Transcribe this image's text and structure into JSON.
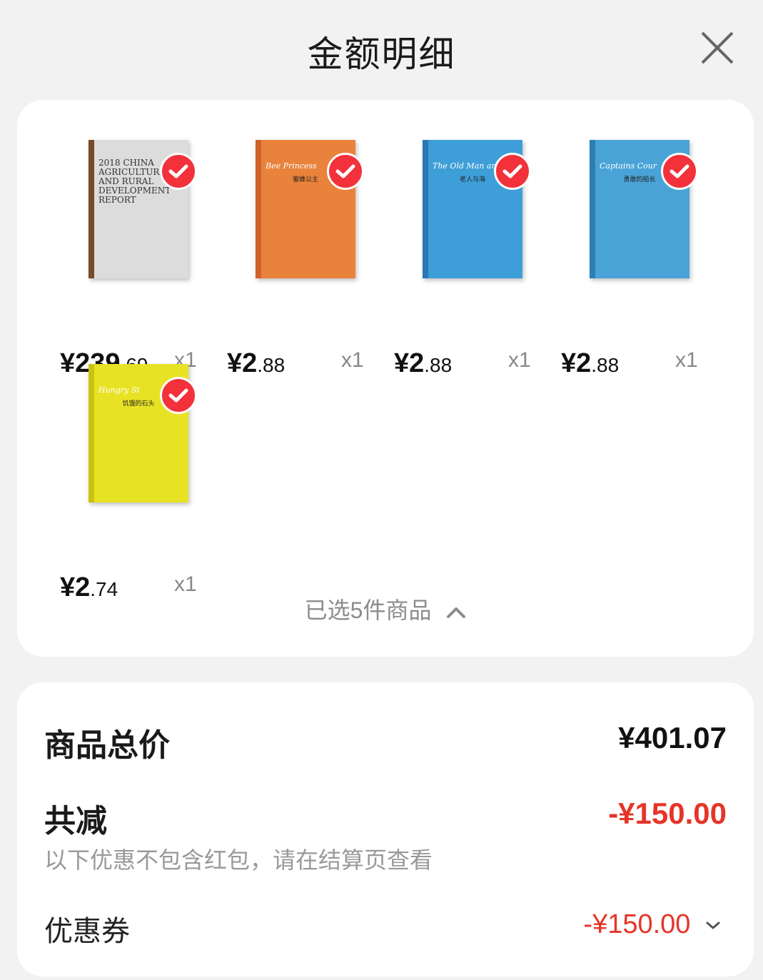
{
  "header": {
    "title": "金额明细",
    "close_icon": "close-icon"
  },
  "products": [
    {
      "price_int": "¥239",
      "price_dec": ".69",
      "qty": "x1",
      "cover_text": "2018 CHINA AGRICULTURAL AND RURAL DEVELOPMENT REPORT",
      "subtitle": "",
      "cover_color": "#dcdcdc",
      "spine_color": "#7a4a2a",
      "checked": true
    },
    {
      "price_int": "¥2",
      "price_dec": ".88",
      "qty": "x1",
      "cover_text": "Bee Princess",
      "subtitle": "蜜蜂公主",
      "cover_color": "#e9823b",
      "spine_color": "#d2602a",
      "checked": true
    },
    {
      "price_int": "¥2",
      "price_dec": ".88",
      "qty": "x1",
      "cover_text": "The Old Man and",
      "subtitle": "老人与海",
      "cover_color": "#3e9ed8",
      "spine_color": "#2a78b5",
      "checked": true
    },
    {
      "price_int": "¥2",
      "price_dec": ".88",
      "qty": "x1",
      "cover_text": "Captains Cour",
      "subtitle": "勇敢的船长",
      "cover_color": "#4aa3d6",
      "spine_color": "#2d7fb3",
      "checked": true
    },
    {
      "price_int": "¥2",
      "price_dec": ".74",
      "qty": "x1",
      "cover_text": "Hungry St",
      "subtitle": "饥饿的石头",
      "cover_color": "#e8e224",
      "spine_color": "#c9c210",
      "checked": true
    }
  ],
  "selection": {
    "label": "已选5件商品",
    "icon": "chevron-up-icon"
  },
  "summary": {
    "total_label": "商品总价",
    "total_value": "¥401.07",
    "discount_label": "共减",
    "discount_value": "-¥150.00",
    "note": "以下优惠不包含红包，请在结算页查看",
    "coupon_label": "优惠券",
    "coupon_value": "-¥150.00",
    "coupon_icon": "chevron-down-icon"
  },
  "colors": {
    "accent_red": "#e53528",
    "check_red": "#f2313a"
  }
}
